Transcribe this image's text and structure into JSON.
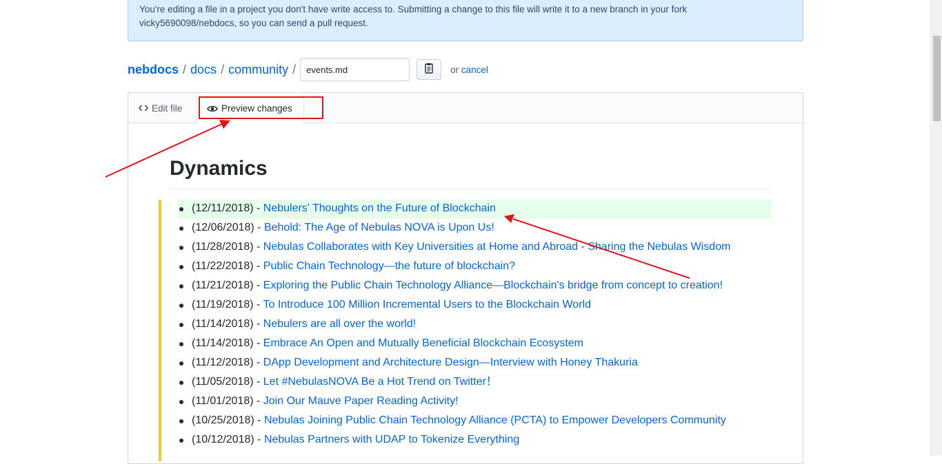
{
  "notice": {
    "line1": "You're editing a file in a project you don't have write access to. Submitting a change to this file will write it to a new branch in your fork",
    "line2": "vicky5690098/nebdocs, so you can send a pull request."
  },
  "breadcrumb": {
    "repo": "nebdocs",
    "sep": "/",
    "path": [
      "docs",
      "community"
    ],
    "filename_value": "events.md",
    "or_text": "or",
    "cancel_label": "cancel"
  },
  "tabs": {
    "edit_label": "Edit file",
    "preview_label": "Preview changes"
  },
  "preview": {
    "heading": "Dynamics",
    "items": [
      {
        "date": "(12/11/2018) - ",
        "title": "Nebulers' Thoughts on the Future of Blockchain",
        "added": true
      },
      {
        "date": "(12/06/2018) - ",
        "title": "Behold: The Age of Nebulas NOVA is Upon Us!"
      },
      {
        "date": "(11/28/2018) - ",
        "title": "Nebulas Collaborates with Key Universities at Home and Abroad - Sharing the Nebulas Wisdom"
      },
      {
        "date": "(11/22/2018) - ",
        "title": "Public Chain Technology—the future of blockchain?"
      },
      {
        "date": "(11/21/2018) - ",
        "title": "Exploring the Public Chain Technology Alliance—Blockchain's bridge from concept to creation!"
      },
      {
        "date": "(11/19/2018) - ",
        "title": "To Introduce 100 Million Incremental Users to the Blockchain World"
      },
      {
        "date": "(11/14/2018) - ",
        "title": "Nebulers are all over the world!"
      },
      {
        "date": "(11/14/2018) - ",
        "title": "Embrace An Open and Mutually Beneficial Blockchain Ecosystem"
      },
      {
        "date": "(11/12/2018) - ",
        "title": "DApp Development and Architecture Design—Interview with Honey Thakuria"
      },
      {
        "date": "(11/05/2018) - ",
        "title": "Let #NebulasNOVA Be a Hot Trend on Twitter！"
      },
      {
        "date": "(11/01/2018) - ",
        "title": "Join Our Mauve Paper Reading Activity!"
      },
      {
        "date": "(10/25/2018) - ",
        "title": "Nebulas Joining Public Chain Technology Alliance (PCTA) to Empower Developers Community"
      },
      {
        "date": "(10/12/2018) - ",
        "title": "Nebulas Partners with UDAP to Tokenize Everything"
      }
    ]
  },
  "colors": {
    "link": "#0366d6",
    "annotation_red": "#e0141b",
    "added_line_bg": "#e6ffed",
    "changed_bar": "#f0c536"
  },
  "icons": [
    "code-icon",
    "eye-icon",
    "clipboard-icon"
  ]
}
